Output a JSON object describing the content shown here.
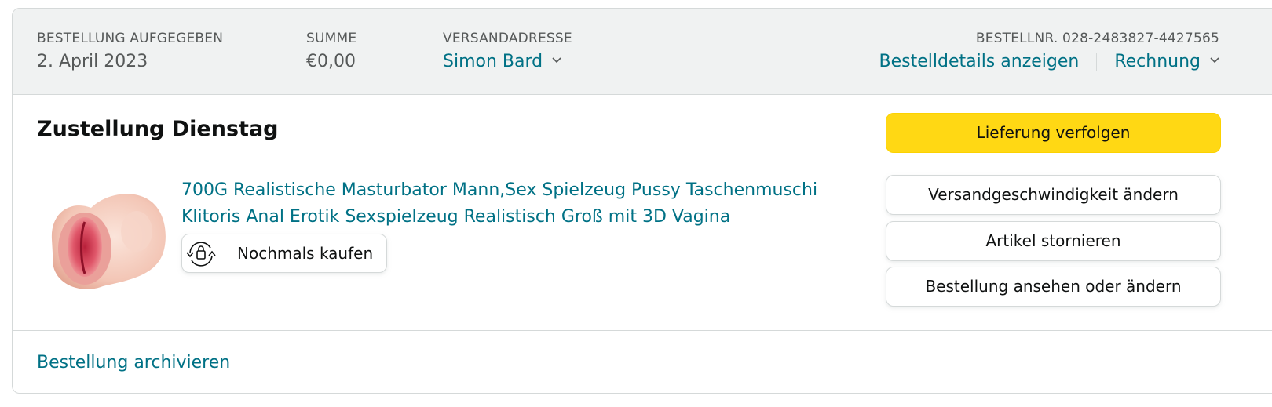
{
  "order_header": {
    "placed": {
      "label": "BESTELLUNG AUFGEGEBEN",
      "value": "2. April 2023"
    },
    "total": {
      "label": "SUMME",
      "value": "€0,00"
    },
    "ship_to": {
      "label": "VERSANDADRESSE",
      "value": "Simon Bard"
    },
    "order_number": {
      "label": "BESTELLNR. 028-2483827-4427565"
    },
    "details_link": "Bestelldetails anzeigen",
    "invoice_link": "Rechnung"
  },
  "shipment": {
    "title": "Zustellung Dienstag",
    "product": {
      "image_icon": "product-thumbnail",
      "title": "700G Realistische Masturbator Mann,Sex Spielzeug Pussy Taschenmuschi Klitoris Anal Erotik Sexspielzeug Realistisch Groß mit 3D Vagina",
      "buy_again_icon": "buy-again-icon",
      "buy_again_label": "Nochmals kaufen"
    }
  },
  "actions": {
    "track": "Lieferung verfolgen",
    "change_speed": "Versandgeschwindigkeit ändern",
    "cancel": "Artikel stornieren",
    "view_edit": "Bestellung ansehen oder ändern"
  },
  "footer": {
    "archive_link": "Bestellung archivieren"
  },
  "colors": {
    "link": "#007185",
    "primary_button": "#FFD814",
    "header_bg": "#F0F2F2",
    "border": "#D5D9D9"
  }
}
